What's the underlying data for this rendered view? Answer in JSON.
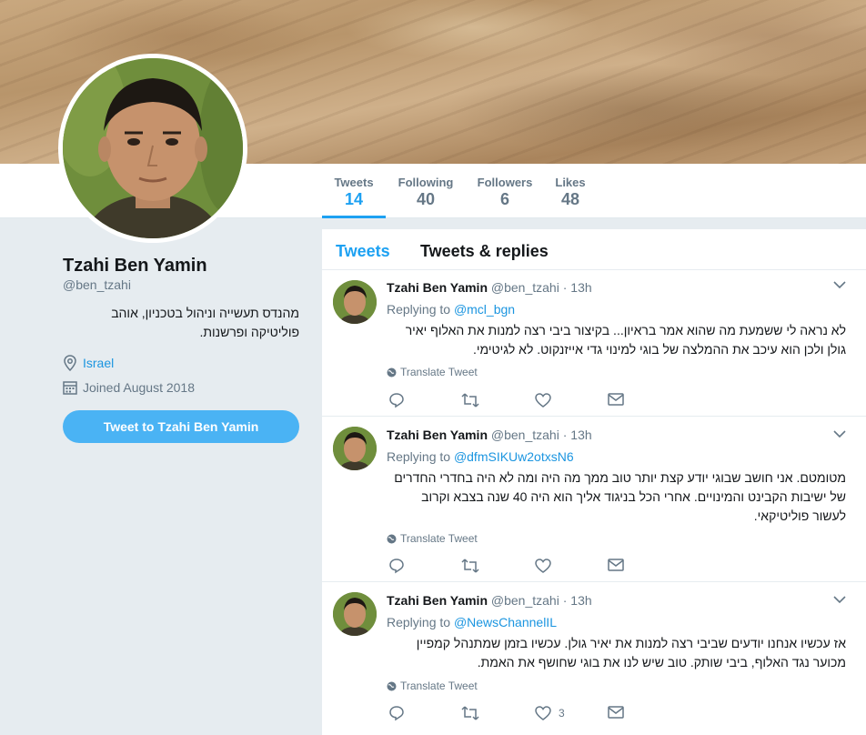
{
  "profile": {
    "name": "Tzahi Ben Yamin",
    "handle": "@ben_tzahi",
    "bio": "מהנדס תעשייה וניהול בטכניון, אוהב פוליטיקה ופרשנות.",
    "location": "Israel",
    "joined": "Joined August 2018",
    "tweet_to_label": "Tweet to Tzahi Ben Yamin"
  },
  "stats": [
    {
      "label": "Tweets",
      "value": "14",
      "active": true
    },
    {
      "label": "Following",
      "value": "40",
      "active": false
    },
    {
      "label": "Followers",
      "value": "6",
      "active": false
    },
    {
      "label": "Likes",
      "value": "48",
      "active": false
    }
  ],
  "timeline": {
    "tabs": [
      "Tweets",
      "Tweets & replies"
    ],
    "translate_label": "Translate Tweet",
    "replying_prefix": "Replying to",
    "tweets": [
      {
        "name": "Tzahi Ben Yamin",
        "handle": "@ben_tzahi",
        "time": "13h",
        "reply_to": "@mcl_bgn",
        "text": "לא נראה לי ששמעת מה שהוא אמר בראיון... בקיצור ביבי רצה למנות את האלוף יאיר גולן ולכן הוא עיכב את ההמלצה של בוגי למינוי גדי אייזנקוט. לא לגיטימי.",
        "likes": ""
      },
      {
        "name": "Tzahi Ben Yamin",
        "handle": "@ben_tzahi",
        "time": "13h",
        "reply_to": "@dfmSIKUw2otxsN6",
        "text": "מטומטם. אני חושב שבוגי יודע קצת יותר טוב ממך מה היה ומה לא היה בחדרי החדרים של ישיבות הקבינט והמינויים. אחרי הכל בניגוד אליך הוא היה 40 שנה בצבא וקרוב לעשור פוליטיקאי.",
        "likes": ""
      },
      {
        "name": "Tzahi Ben Yamin",
        "handle": "@ben_tzahi",
        "time": "13h",
        "reply_to": "@NewsChannelIL",
        "text": "אז עכשיו אנחנו יודעים שביבי רצה למנות את יאיר גולן. עכשיו בזמן שמתנהל קמפיין מכוער נגד האלוף, ביבי שותק. טוב שיש לנו את בוגי שחושף את האמת.",
        "likes": "3"
      }
    ]
  },
  "colors": {
    "accent": "#1da1f2",
    "button": "#4ab3f4",
    "muted": "#657786",
    "background": "#e6ecf0"
  }
}
